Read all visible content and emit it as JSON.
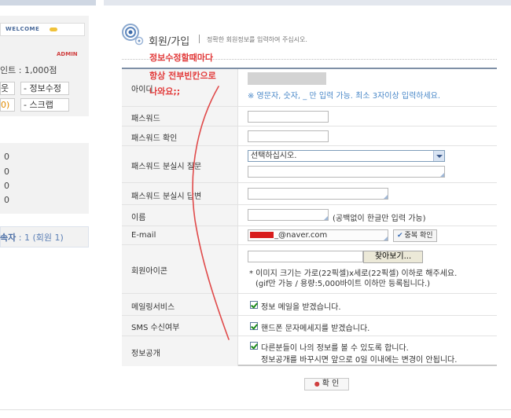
{
  "sidebar": {
    "welcome": "WELCOME",
    "admin_badge": "ADMIN",
    "points": "인트 : 1,000점",
    "buttons": [
      "웃",
      "정보수정",
      "0)",
      "스크랩"
    ],
    "counts": [
      "0",
      "0",
      "0",
      "0"
    ],
    "visitors": {
      "label": "속자",
      "value": " : 1 (회원 1)"
    }
  },
  "header": {
    "title": "회원/가입",
    "subtitle": "정확한 회원정보를 입력하여 주십시오."
  },
  "annotation": {
    "lines": [
      "정보수정할때마다",
      "항상 전부빈칸으로",
      "나와요;;"
    ]
  },
  "form": {
    "id_label": "아이디",
    "id_hint": "※ 영문자, 숫자, _ 만 입력 가능. 최소 3자이상 입력하세요.",
    "pw_label": "패스워드",
    "pw_confirm_label": "패스워드 확인",
    "pw_question_label": "패스워드 분실시 질문",
    "pw_question_value": "선택하십시오.",
    "pw_answer_label": "패스워드 분실시 답변",
    "name_label": "이름",
    "name_note": "(공백없이 한글만 입력 가능)",
    "email_label": "E-mail",
    "email_value": "_@naver.com",
    "dup_check": "중복 확인",
    "icon_label": "회원아이콘",
    "browse": "찾아보기...",
    "icon_note_1": "* 이미지 크기는 가로(22픽셀)x세로(22픽셀) 이하로 해주세요.",
    "icon_note_2": "(gif만 가능 / 용량:5,000바이트 이하만 등록됩니다.)",
    "mailing_label": "메일링서비스",
    "mailing_text": "정보 메일을 받겠습니다.",
    "sms_label": "SMS 수신여부",
    "sms_text": "핸드폰 문자메세지를 받겠습니다.",
    "public_label": "정보공개",
    "public_text_1": "다른분들이 나의 정보를 볼 수 있도록 합니다.",
    "public_text_2": "정보공개를 바꾸시면 앞으로 0일 이내에는 변경이 안됩니다."
  },
  "confirm": "확 인",
  "colors": {
    "accent": "#4a88c8",
    "annotation": "#e23a3a",
    "table_border": "#7e8fa6"
  }
}
